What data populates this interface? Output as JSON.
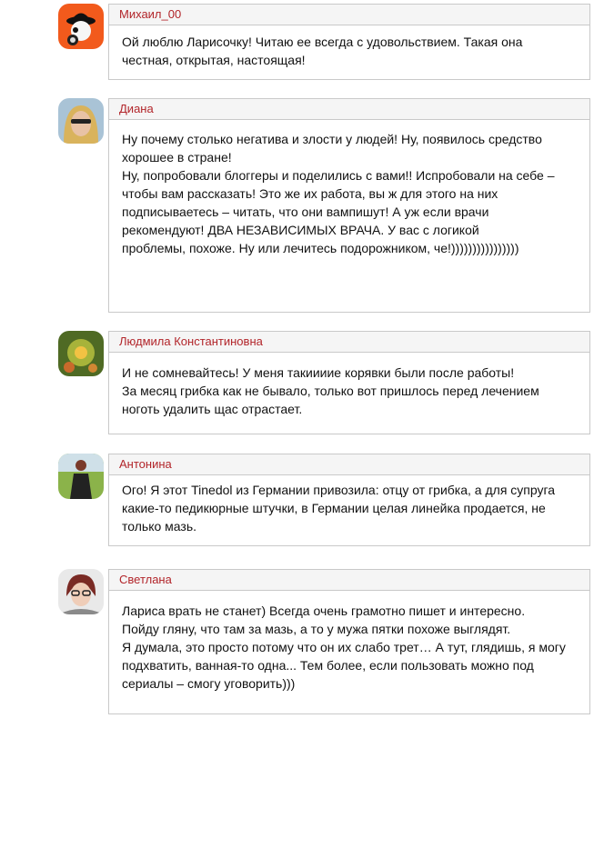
{
  "comments": [
    {
      "author": "Михаил_00",
      "avatar_icon": "clockwork-orange-avatar-icon",
      "text": "Ой люблю Ларисочку! Читаю ее всегда с удовольствием. Такая она\nчестная, открытая, настоящая!"
    },
    {
      "author": "Диана",
      "avatar_icon": "woman-sunglasses-avatar-icon",
      "text": "Ну почему столько негатива и злости у людей! Ну, появилось средство\nхорошее в стране!\nНу, попробовали блоггеры и поделились с вами!! Испробовали на себе –\nчтобы вам рассказать! Это же их работа, вы ж для этого на них\nподписываетесь – читать, что они вампишут! А уж если врачи\nрекомендуют! ДВА НЕЗАВИСИМЫХ ВРАЧА. У вас с логикой\nпроблемы, похоже. Ну или лечитесь подорожником, че!))))))))))))))))"
    },
    {
      "author": "Людмила Константиновна",
      "avatar_icon": "flower-avatar-icon",
      "text": "И не сомневайтесь! У меня такиииие корявки были после работы!\nЗа месяц грибка как не бывало, только вот пришлось перед лечением\nноготь удалить щас отрастает."
    },
    {
      "author": "Антонина",
      "avatar_icon": "woman-outdoor-avatar-icon",
      "text": "Ого! Я этот Tinedol из Германии привозила: отцу от грибка, а для супруга\nкакие-то педикюрные штучки, в Германии целая линейка продается, не\nтолько мазь."
    },
    {
      "author": "Светлана",
      "avatar_icon": "woman-glasses-avatar-icon",
      "text": "Лариса врать не станет) Всегда очень грамотно пишет и интересно.\nПойду гляну, что там за мазь, а то у мужа пятки похоже выглядят.\nЯ думала, это просто потому что он их слабо трет… А тут, глядишь, я могу\n подхватить, ванная-то одна... Тем более, если пользовать можно под\nсериалы – смогу уговорить)))"
    }
  ]
}
